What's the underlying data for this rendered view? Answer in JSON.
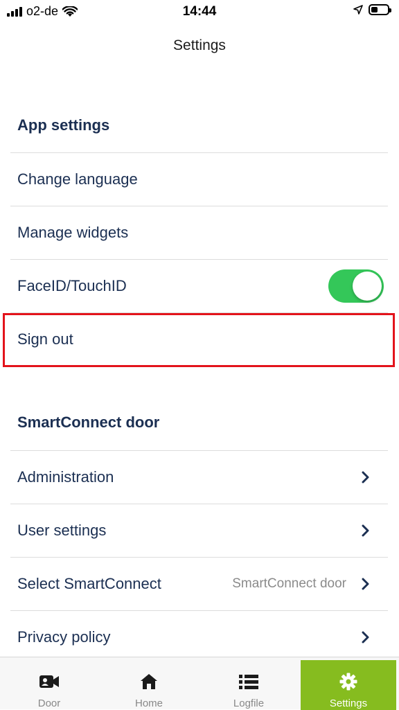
{
  "status_bar": {
    "carrier": "o2-de",
    "time": "14:44",
    "icons": [
      "signal-icon",
      "wifi-icon",
      "location-arrow-icon",
      "battery-icon"
    ]
  },
  "nav": {
    "title": "Settings"
  },
  "sections": {
    "app_settings": {
      "title": "App settings",
      "items": {
        "change_language": "Change language",
        "manage_widgets": "Manage widgets",
        "faceid": "FaceID/TouchID",
        "faceid_enabled": true,
        "sign_out": "Sign out"
      }
    },
    "smartconnect": {
      "title": "SmartConnect door",
      "items": {
        "administration": "Administration",
        "user_settings": "User settings",
        "select_smartconnect": "Select SmartConnect",
        "select_smartconnect_value": "SmartConnect door",
        "privacy_policy": "Privacy policy"
      }
    }
  },
  "tabs": {
    "door": "Door",
    "home": "Home",
    "logfile": "Logfile",
    "settings": "Settings",
    "active": "settings"
  },
  "colors": {
    "text_primary": "#1b2f52",
    "toggle_on": "#34c759",
    "active_tab": "#86bc1f",
    "highlight": "#e3131b"
  }
}
